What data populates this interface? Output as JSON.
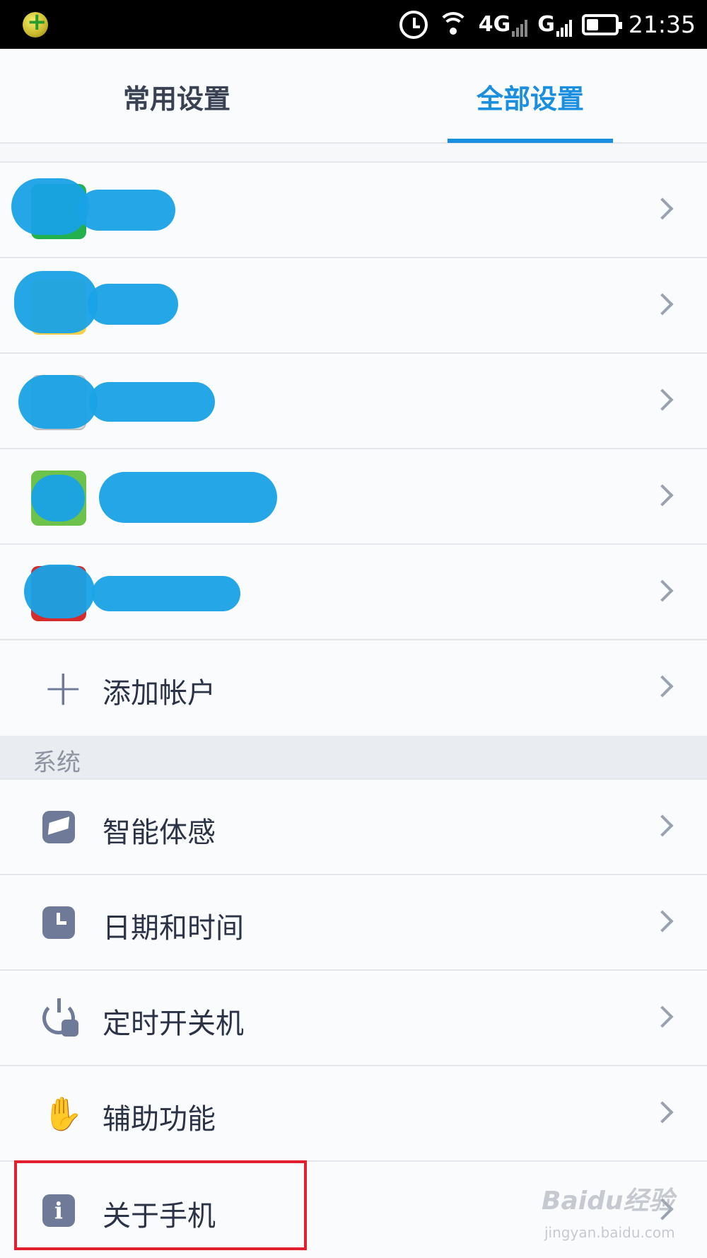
{
  "status_bar": {
    "network_1": "4G",
    "sim_1": "1",
    "network_2": "G",
    "sim_2": "2",
    "time": "21:35"
  },
  "tabs": [
    {
      "label": "常用设置",
      "active": false
    },
    {
      "label": "全部设置",
      "active": true
    }
  ],
  "accounts": [
    {
      "icon_color": "#23b14d",
      "obscured": true
    },
    {
      "icon_color": "#f4d04a",
      "obscured": true
    },
    {
      "icon_color": "#d9d9d9",
      "obscured": true
    },
    {
      "icon_color": "#6cc24a",
      "obscured": true
    },
    {
      "icon_color": "#d62b2b",
      "obscured": true
    }
  ],
  "add_account": {
    "label": "添加帐户",
    "icon": "plus-icon"
  },
  "section_system": {
    "label": "系统"
  },
  "system_items": [
    {
      "label": "智能体感",
      "icon": "motion-icon"
    },
    {
      "label": "日期和时间",
      "icon": "clock-icon"
    },
    {
      "label": "定时开关机",
      "icon": "power-timer-icon"
    },
    {
      "label": "辅助功能",
      "icon": "hand-icon"
    },
    {
      "label": "关于手机",
      "icon": "info-icon"
    }
  ],
  "watermark": {
    "brand": "Baidu经验",
    "url": "jingyan.baidu.com"
  },
  "colors": {
    "accent": "#1a8fe0",
    "highlight_border": "#e0202e",
    "icon_gray": "#6e7a97"
  }
}
